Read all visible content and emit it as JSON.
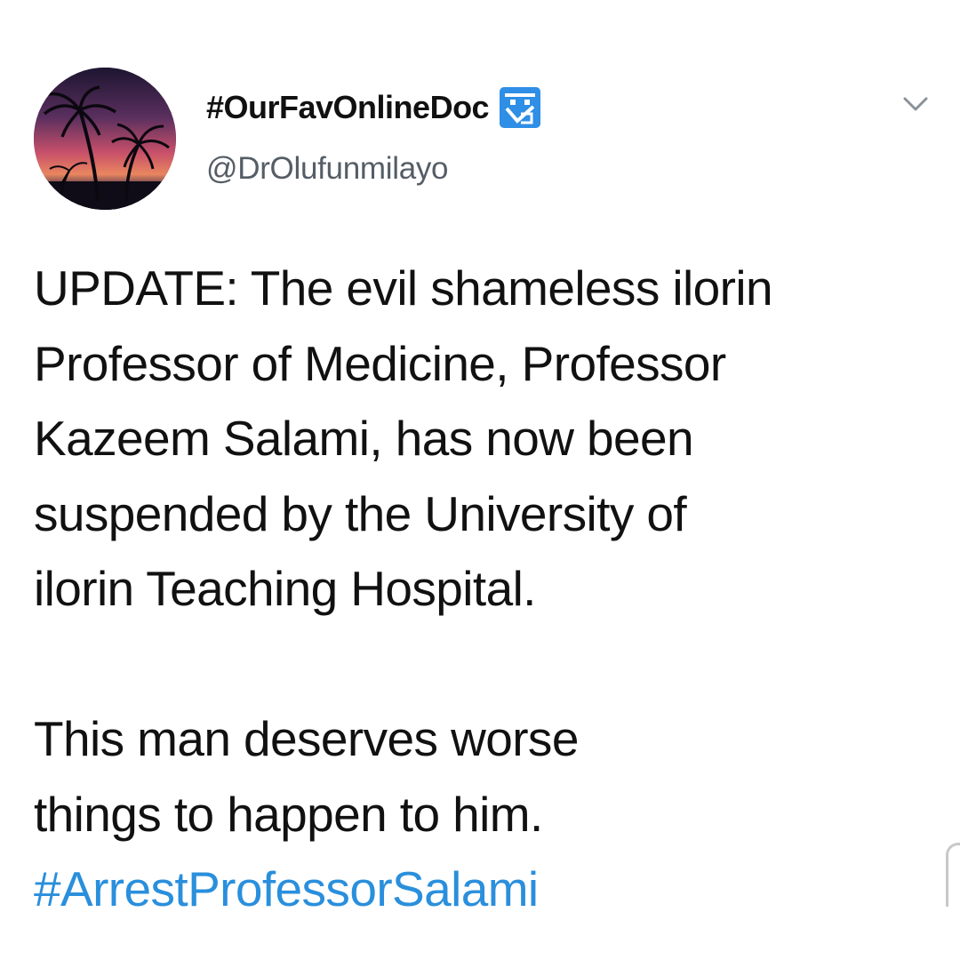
{
  "author": {
    "display_name": "#OurFavOnlineDoc",
    "handle": "@DrOlufunmilayo",
    "avatar_icon": "palm-tree-sunset-avatar",
    "badge_icon": "doctor-emoji-badge"
  },
  "menu": {
    "icon": "chevron-down-icon"
  },
  "tweet": {
    "lines": [
      "UPDATE: The evil shameless ilorin",
      "Professor of Medicine, Professor",
      "Kazeem Salami, has now been",
      "suspended by the University of",
      "ilorin Teaching Hospital.",
      "This man deserves worse",
      "things to happen to him."
    ],
    "hashtag": "#ArrestProfessorSalami"
  },
  "colors": {
    "text": "#111111",
    "handle": "#555d66",
    "link": "#2a8fdc",
    "badge": "#2f8ee6"
  }
}
